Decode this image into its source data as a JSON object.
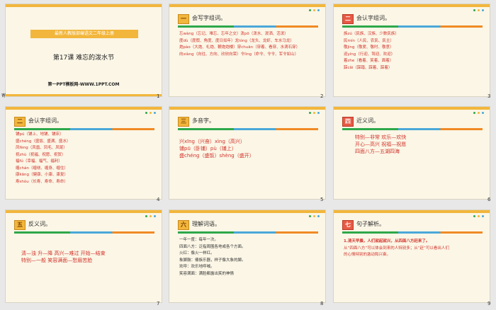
{
  "colors": {
    "accent": "#f2b63c",
    "red_text": "#d2342c",
    "badge_red": "#e85a44"
  },
  "slides": [
    {
      "num": "1",
      "side_label": "寄",
      "banner": "最新人教版部编语文二年级上册",
      "title": "第17课  难忘的泼水节",
      "subtitle": "第一PPT模板网-WWW.1PPT.COM"
    },
    {
      "num": "2",
      "badge": "一",
      "heading": "会写字组词。",
      "lines": [
        "忘wàng（忘记、难忘、忘年之交）泼pō（泼水、泼洒、活泼）",
        "度dù（度假、角度、度日如年）龙lóng（龙头、龙虾、车水马龙）",
        "炮pào（大炮、礼炮、鞭炮炮楼）穿chuān（穿着、看穿、水滴石穿）",
        "向xiàng（向往、方向、欣欣向荣）令lìng（命令、令令、军令如山）"
      ]
    },
    {
      "num": "3",
      "badge": "二",
      "heading": "会认字组词。",
      "lines": [
        "族zú（民族、汉族、少数民族）",
        "民mín（人民、农民、民主）",
        "敬jìng（敬爱、敬时、敬意）",
        "迎yíng（行迎、驾迎、欢迎）",
        "着zhe（看着、笑着、面着）",
        "踩cǎi（踩踏、踩着、踩着）"
      ]
    },
    {
      "num": "4",
      "badge": "二",
      "heading": "会认字组词。",
      "lines": [
        "铺pū（铺上、地铺、铺床）",
        "盛chéng（盛饭、盛满、盛水）",
        "凤fèng（凤凰、凤毛、凤尾）",
        "祝zhù（祝福、祝愿、祝贺）",
        "福fú（幸福、福气、福利）",
        "缠chán（缠绕、缠身、缠住）",
        "康kāng（健康、小康、康复）",
        "寿shòu（长寿、寿命、寿命）"
      ]
    },
    {
      "num": "5",
      "badge": "三",
      "heading": "多音字。",
      "lines": [
        "兴xīng（兴奋）xìng（高兴）",
        "铺pū（卧铺）pù（铺上）",
        "盛chéng（盛饭）shèng（盛开）"
      ]
    },
    {
      "num": "6",
      "badge": "四",
      "heading": "近义词。",
      "lines": [
        "特别—非常  欢乐—欢快",
        "开心—高兴  祝福—祝愿",
        "四面八方—五湖四海"
      ]
    },
    {
      "num": "7",
      "badge": "五",
      "heading": "反义词。",
      "lines": [
        "清—浊  升—降  高兴—难过  开始—结束",
        "特别—一般  笑容满面—愁眉苦脸"
      ]
    },
    {
      "num": "8",
      "badge": "六",
      "heading": "理解词语。",
      "lines": [
        "一年一度：每年一次。",
        "四面八方：泛指周围各地或各个方面。",
        "火红：像火一样红。",
        "象脚鼓：傣族乐器，样子像大象的脚。",
        "欢呼：欢乐地呼喊。",
        "笑容满面：满脸都露出笑的神情"
      ]
    },
    {
      "num": "9",
      "badge": "七",
      "heading": "句子解析。",
      "lines": [
        "1.清天早晨，人们就起就兴，从四面八方赶来了。",
        "",
        "从“四面八方”可以体会到来的人特别多；从“赶”可以看出人们",
        "的心情特别的激动和兴奋。"
      ]
    }
  ]
}
